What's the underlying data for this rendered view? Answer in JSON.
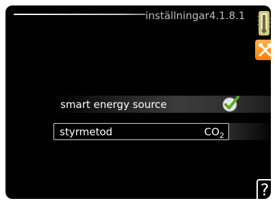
{
  "header": {
    "title": "inställningar4.1.8.1"
  },
  "icons": {
    "thermometer": "thermometer-icon",
    "settings": "tools-icon",
    "check": "checkmark-icon",
    "help": "help-icon"
  },
  "rows": [
    {
      "label": "smart energy source",
      "checked": true
    },
    {
      "label": "styrmetod",
      "value_main": "CO",
      "value_sub": "2"
    }
  ],
  "help": {
    "label": "?"
  },
  "colors": {
    "background": "#000000",
    "accent": "#ff8c1a",
    "check": "#6dbb2b",
    "text": "#ffffff",
    "header_text": "#bdbdbd"
  }
}
